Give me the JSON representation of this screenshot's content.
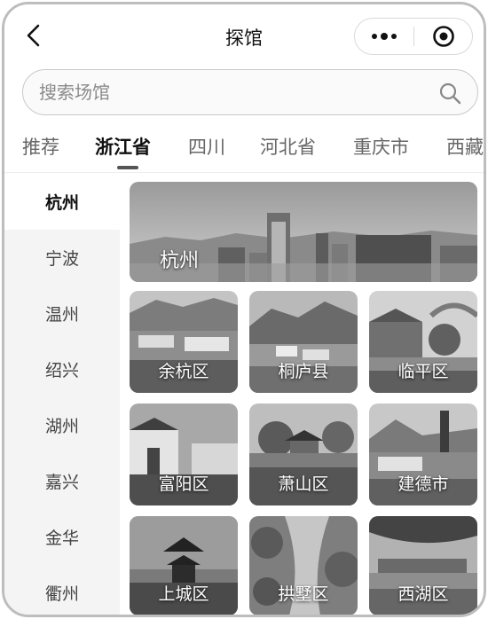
{
  "header": {
    "title": "探馆",
    "back_icon": "chevron-left-icon",
    "more_icon": "more-dots-icon",
    "close_icon": "target-circle-icon"
  },
  "search": {
    "placeholder": "搜索场馆",
    "icon": "search-icon"
  },
  "tabs": [
    {
      "label": "推荐",
      "active": false
    },
    {
      "label": "浙江省",
      "active": true
    },
    {
      "label": "四川",
      "active": false
    },
    {
      "label": "河北省",
      "active": false
    },
    {
      "label": "重庆市",
      "active": false
    },
    {
      "label": "西藏",
      "active": false
    }
  ],
  "cities": [
    {
      "label": "杭州",
      "active": true
    },
    {
      "label": "宁波",
      "active": false
    },
    {
      "label": "温州",
      "active": false
    },
    {
      "label": "绍兴",
      "active": false
    },
    {
      "label": "湖州",
      "active": false
    },
    {
      "label": "嘉兴",
      "active": false
    },
    {
      "label": "金华",
      "active": false
    },
    {
      "label": "衢州",
      "active": false
    }
  ],
  "featured": {
    "label": "杭州"
  },
  "districts": [
    {
      "label": "余杭区"
    },
    {
      "label": "桐庐县"
    },
    {
      "label": "临平区"
    },
    {
      "label": "富阳区"
    },
    {
      "label": "萧山区"
    },
    {
      "label": "建德市"
    },
    {
      "label": "上城区"
    },
    {
      "label": "拱墅区"
    },
    {
      "label": "西湖区"
    }
  ]
}
